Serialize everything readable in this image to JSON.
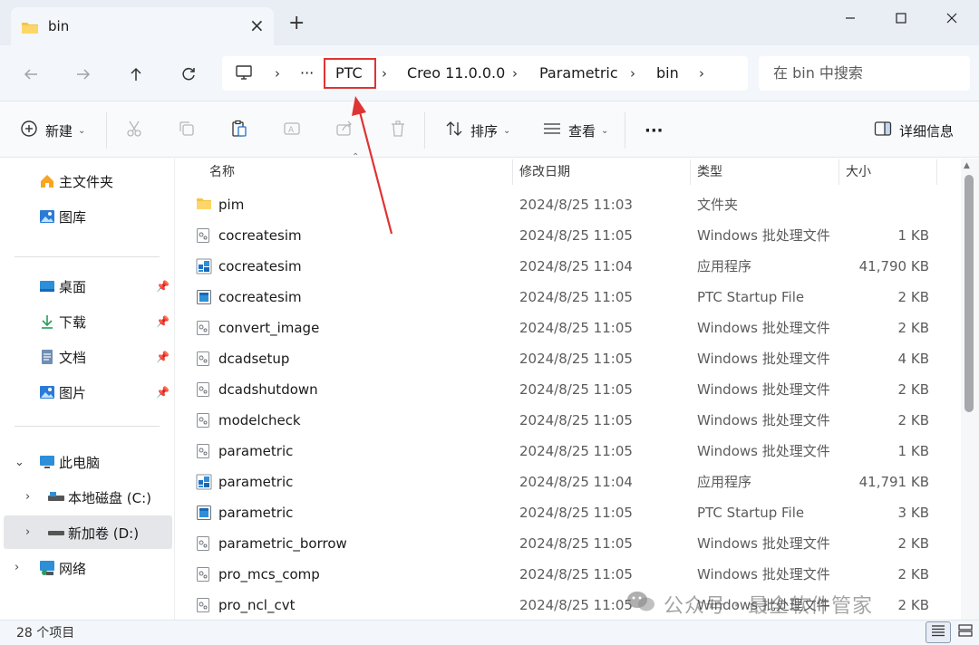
{
  "window": {
    "tab_title": "bin",
    "new_tab": "+",
    "close_tab": "×"
  },
  "address": {
    "ellipsis": "···",
    "crumbs": [
      "PTC",
      "Creo 11.0.0.0",
      "Parametric",
      "bin"
    ],
    "search_placeholder": "在 bin 中搜索"
  },
  "toolbar": {
    "new_label": "新建",
    "sort_label": "排序",
    "view_label": "查看",
    "more_label": "···",
    "details_label": "详细信息"
  },
  "sidebar": {
    "quick": [
      {
        "label": "主文件夹",
        "icon": "home-icon"
      },
      {
        "label": "图库",
        "icon": "gallery-icon"
      }
    ],
    "pinned": [
      {
        "label": "桌面",
        "icon": "desktop-icon"
      },
      {
        "label": "下载",
        "icon": "download-icon"
      },
      {
        "label": "文档",
        "icon": "document-icon"
      },
      {
        "label": "图片",
        "icon": "pictures-icon"
      }
    ],
    "this_pc": "此电脑",
    "drives": [
      {
        "label": "本地磁盘 (C:)",
        "icon": "drive-icon"
      },
      {
        "label": "新加卷 (D:)",
        "icon": "drive-icon",
        "selected": true
      }
    ],
    "network": "网络"
  },
  "columns": {
    "name": "名称",
    "date": "修改日期",
    "type": "类型",
    "size": "大小"
  },
  "files": [
    {
      "name": "pim",
      "date": "2024/8/25 11:03",
      "type": "文件夹",
      "size": "",
      "icon": "folder-icon"
    },
    {
      "name": "cocreatesim",
      "date": "2024/8/25 11:05",
      "type": "Windows 批处理文件",
      "size": "1 KB",
      "icon": "batch-file-icon"
    },
    {
      "name": "cocreatesim",
      "date": "2024/8/25 11:04",
      "type": "应用程序",
      "size": "41,790 KB",
      "icon": "application-icon"
    },
    {
      "name": "cocreatesim",
      "date": "2024/8/25 11:05",
      "type": "PTC Startup File",
      "size": "2 KB",
      "icon": "startup-file-icon"
    },
    {
      "name": "convert_image",
      "date": "2024/8/25 11:05",
      "type": "Windows 批处理文件",
      "size": "2 KB",
      "icon": "batch-file-icon"
    },
    {
      "name": "dcadsetup",
      "date": "2024/8/25 11:05",
      "type": "Windows 批处理文件",
      "size": "4 KB",
      "icon": "batch-file-icon"
    },
    {
      "name": "dcadshutdown",
      "date": "2024/8/25 11:05",
      "type": "Windows 批处理文件",
      "size": "2 KB",
      "icon": "batch-file-icon"
    },
    {
      "name": "modelcheck",
      "date": "2024/8/25 11:05",
      "type": "Windows 批处理文件",
      "size": "2 KB",
      "icon": "batch-file-icon"
    },
    {
      "name": "parametric",
      "date": "2024/8/25 11:05",
      "type": "Windows 批处理文件",
      "size": "1 KB",
      "icon": "batch-file-icon"
    },
    {
      "name": "parametric",
      "date": "2024/8/25 11:04",
      "type": "应用程序",
      "size": "41,791 KB",
      "icon": "application-icon"
    },
    {
      "name": "parametric",
      "date": "2024/8/25 11:05",
      "type": "PTC Startup File",
      "size": "3 KB",
      "icon": "startup-file-icon"
    },
    {
      "name": "parametric_borrow",
      "date": "2024/8/25 11:05",
      "type": "Windows 批处理文件",
      "size": "2 KB",
      "icon": "batch-file-icon"
    },
    {
      "name": "pro_mcs_comp",
      "date": "2024/8/25 11:05",
      "type": "Windows 批处理文件",
      "size": "2 KB",
      "icon": "batch-file-icon"
    },
    {
      "name": "pro_ncl_cvt",
      "date": "2024/8/25 11:05",
      "type": "Windows 批处理文件",
      "size": "2 KB",
      "icon": "batch-file-icon"
    }
  ],
  "status": {
    "count": "28 个项目"
  },
  "watermark": "公众号 · 最全软件管家",
  "colors": {
    "annotation_red": "#e03333",
    "folder_yellow": "#f6c343",
    "accent_blue": "#1f6fc7"
  }
}
